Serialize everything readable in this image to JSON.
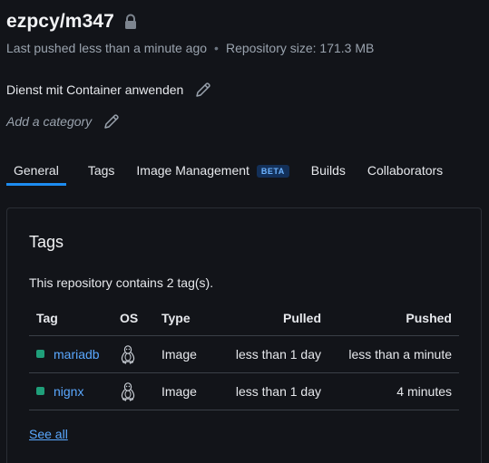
{
  "repo": {
    "title": "ezpcy/m347",
    "last_pushed": "Last pushed less than a minute ago",
    "separator": "•",
    "size": "Repository size: 171.3 MB",
    "description": "Dienst mit Container anwenden",
    "category_placeholder": "Add a category"
  },
  "tabs": [
    {
      "label": "General",
      "active": true
    },
    {
      "label": "Tags"
    },
    {
      "label": "Image Management",
      "badge": "BETA"
    },
    {
      "label": "Builds"
    },
    {
      "label": "Collaborators"
    }
  ],
  "tags_panel": {
    "title": "Tags",
    "summary": "This repository contains 2 tag(s).",
    "columns": {
      "tag": "Tag",
      "os": "OS",
      "type": "Type",
      "pulled": "Pulled",
      "pushed": "Pushed"
    },
    "rows": [
      {
        "tag": "mariadb",
        "os_icon": "linux-icon",
        "type": "Image",
        "pulled": "less than 1 day",
        "pushed": "less than a minute"
      },
      {
        "tag": "nignx",
        "os_icon": "linux-icon",
        "type": "Image",
        "pulled": "less than 1 day",
        "pushed": "4 minutes"
      }
    ],
    "see_all": "See all"
  },
  "colors": {
    "accent": "#1d8cf0",
    "link": "#5aa8ff",
    "tag_status": "#1f9f7a",
    "background": "#121419"
  }
}
